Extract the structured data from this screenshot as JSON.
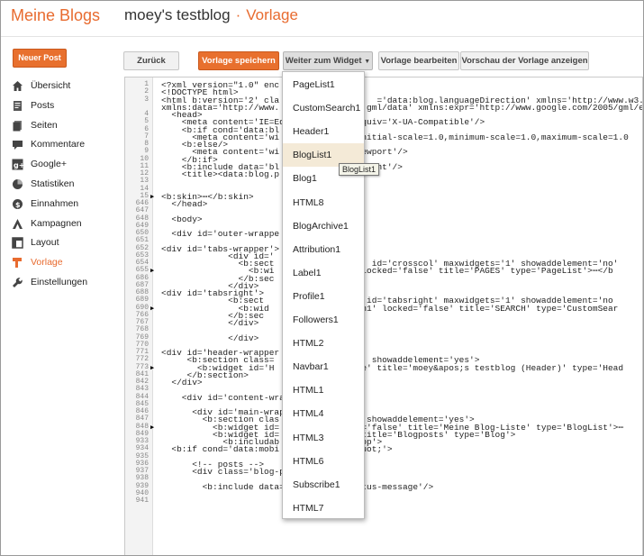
{
  "header": {
    "brand": "Meine Blogs",
    "blog_title": "moey's testblog",
    "separator": "·",
    "crumb": "Vorlage"
  },
  "new_post_label": "Neuer Post",
  "nav": [
    {
      "label": "Übersicht",
      "icon": "home-icon"
    },
    {
      "label": "Posts",
      "icon": "posts-icon"
    },
    {
      "label": "Seiten",
      "icon": "pages-icon"
    },
    {
      "label": "Kommentare",
      "icon": "comments-icon"
    },
    {
      "label": "Google+",
      "icon": "google-plus-icon"
    },
    {
      "label": "Statistiken",
      "icon": "stats-icon"
    },
    {
      "label": "Einnahmen",
      "icon": "earnings-icon"
    },
    {
      "label": "Kampagnen",
      "icon": "campaigns-icon"
    },
    {
      "label": "Layout",
      "icon": "layout-icon"
    },
    {
      "label": "Vorlage",
      "icon": "template-icon",
      "active": true
    },
    {
      "label": "Einstellungen",
      "icon": "wrench-icon"
    }
  ],
  "toolbar": {
    "back": "Zurück",
    "save": "Vorlage speichern",
    "jump": "Weiter zum Widget",
    "edit": "Vorlage bearbeiten",
    "preview": "Vorschau der Vorlage anzeigen"
  },
  "dropdown": [
    "PageList1",
    "CustomSearch1",
    "Header1",
    "BlogList1",
    "Blog1",
    "HTML8",
    "BlogArchive1",
    "Attribution1",
    "Label1",
    "Profile1",
    "Followers1",
    "HTML2",
    "Navbar1",
    "HTML1",
    "HTML4",
    "HTML3",
    "HTML6",
    "Subscribe1",
    "HTML7"
  ],
  "tooltip": "BlogList1",
  "code": [
    {
      "n": "1",
      "t": "<?xml version=\"1.0\" enc"
    },
    {
      "n": "2",
      "t": "<!DOCTYPE html>"
    },
    {
      "n": "3",
      "t": "<html b:version='2' cla                   ='data:blog.languageDirection' xmlns='http://www.w3.or"
    },
    {
      "n": "",
      "t": "xmlns:data='http://www.                 gml/data' xmlns:expr='http://www.google.com/2005/gml/e"
    },
    {
      "n": "4",
      "t": "  <head>"
    },
    {
      "n": "5",
      "t": "    <meta content='IE=Ed              equiv='X-UA-Compatible'/>"
    },
    {
      "n": "6",
      "t": "    <b:if cond='data:bl"
    },
    {
      "n": "7",
      "t": "      <meta content='wi              ,initial-scale=1.0,minimum-scale=1.0,maximum-scale=1.0"
    },
    {
      "n": "8",
      "t": "    <b:else/>"
    },
    {
      "n": "9",
      "t": "      <meta content='wi              viewport'/>"
    },
    {
      "n": "10",
      "t": "    </b:if>"
    },
    {
      "n": "11",
      "t": "    <b:include data='bl              content'/>"
    },
    {
      "n": "12",
      "t": "    <title><data:blog.p              e>"
    },
    {
      "n": "13",
      "t": ""
    },
    {
      "n": "14",
      "t": ""
    },
    {
      "n": "15",
      "t": "<b:skin>⋯</b:skin>",
      "fold": true
    },
    {
      "n": "646",
      "t": "  </head>"
    },
    {
      "n": "647",
      "t": ""
    },
    {
      "n": "648",
      "t": "  <body>"
    },
    {
      "n": "649",
      "t": ""
    },
    {
      "n": "650",
      "t": "  <div id='outer-wrappe"
    },
    {
      "n": "651",
      "t": ""
    },
    {
      "n": "652",
      "t": "<div id='tabs-wrapper'>"
    },
    {
      "n": "653",
      "t": "             <div id='"
    },
    {
      "n": "654",
      "t": "               <b:sect              eft' id='crosscol' maxwidgets='1' showaddelement='no'"
    },
    {
      "n": "655",
      "t": "                 <b:wi              1' locked='false' title='PAGES' type='PageList'>⋯</b",
      "fold": true
    },
    {
      "n": "686",
      "t": "               </b:sec"
    },
    {
      "n": "687",
      "t": "             </div>"
    },
    {
      "n": "688",
      "t": "<div id='tabsright'>"
    },
    {
      "n": "689",
      "t": "             <b:sect              ight' id='tabsright' maxwidgets='1' showaddelement='no"
    },
    {
      "n": "690",
      "t": "               <b:wid              earch1' locked='false' title='SEARCH' type='CustomSear",
      "fold": true
    },
    {
      "n": "766",
      "t": "             </b:sec"
    },
    {
      "n": "767",
      "t": "             </div>"
    },
    {
      "n": "768",
      "t": ""
    },
    {
      "n": "769",
      "t": "             </div>"
    },
    {
      "n": "770",
      "t": ""
    },
    {
      "n": "771",
      "t": "<div id='header-wrapper"
    },
    {
      "n": "772",
      "t": "     <b:section class=              der' showaddelement='yes'>"
    },
    {
      "n": "773",
      "t": "       <b:widget id='H              true' title='moey&apos;s testblog (Header)' type='Head",
      "fold": true
    },
    {
      "n": "841",
      "t": "     </b:section>"
    },
    {
      "n": "842",
      "t": "  </div>"
    },
    {
      "n": "843",
      "t": ""
    },
    {
      "n": "844",
      "t": "    <div id='content-wra"
    },
    {
      "n": "845",
      "t": ""
    },
    {
      "n": "846",
      "t": "      <div id='main-wrap"
    },
    {
      "n": "847",
      "t": "        <b:section clas              n' showaddelement='yes'>"
    },
    {
      "n": "848",
      "t": "          <b:widget id=              ed='false' title='Meine Blog-Liste' type='BlogList'>⋯",
      "fold": true
    },
    {
      "n": "849",
      "t": "          <b:widget id=              ' title='Blogposts' type='Blog'>"
    },
    {
      "n": "933",
      "t": "            <b:includab              'top'>"
    },
    {
      "n": "934",
      "t": "  <b:if cond='data:mobi              &quot;'>"
    },
    {
      "n": "935",
      "t": ""
    },
    {
      "n": "936",
      "t": "      <!-- posts -->"
    },
    {
      "n": "937",
      "t": "      <div class='blog-posts hfeed'>"
    },
    {
      "n": "938",
      "t": ""
    },
    {
      "n": "939",
      "t": "        <b:include data='top' name='status-message'/>"
    },
    {
      "n": "940",
      "t": ""
    },
    {
      "n": "941",
      "t": ""
    }
  ]
}
